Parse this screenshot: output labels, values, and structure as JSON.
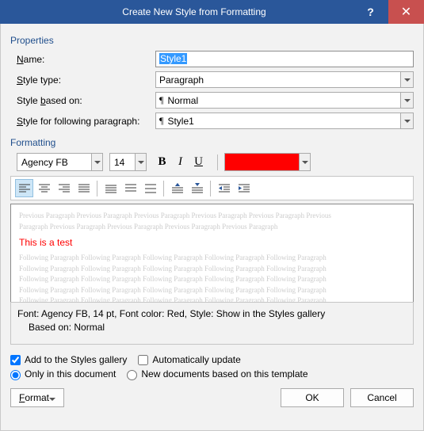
{
  "titlebar": {
    "title": "Create New Style from Formatting"
  },
  "sections": {
    "properties": "Properties",
    "formatting": "Formatting"
  },
  "labels": {
    "name": "ame:",
    "name_ul": "N",
    "styletype": "tyle type:",
    "styletype_ul": "S",
    "basedon": "Style ",
    "basedon_ul": "b",
    "basedon2": "ased on:",
    "following": "tyle for following paragraph:",
    "following_ul": "S"
  },
  "values": {
    "name": "Style1",
    "styletype": "Paragraph",
    "basedon": "Normal",
    "following": "Style1",
    "font": "Agency FB",
    "size": "14",
    "color": "#ff0000"
  },
  "preview": {
    "prev1": "Previous Paragraph Previous Paragraph Previous Paragraph Previous Paragraph Previous Paragraph Previous",
    "prev2": "Paragraph Previous Paragraph Previous Paragraph Previous Paragraph Previous Paragraph",
    "sample": "This is a test",
    "foll": "Following Paragraph Following Paragraph Following Paragraph Following Paragraph Following Paragraph"
  },
  "description": {
    "line1": "Font: Agency FB, 14 pt, Font color: Red, Style: Show in the Styles gallery",
    "line2": "Based on: Normal"
  },
  "checks": {
    "addgallery": "Add to the Styles gallery",
    "autoupdate": "Automatically update",
    "onlydoc": "Only in this document",
    "newdocs": "New documents based on this template"
  },
  "buttons": {
    "format": "Format",
    "ok": "OK",
    "cancel": "Cancel"
  }
}
